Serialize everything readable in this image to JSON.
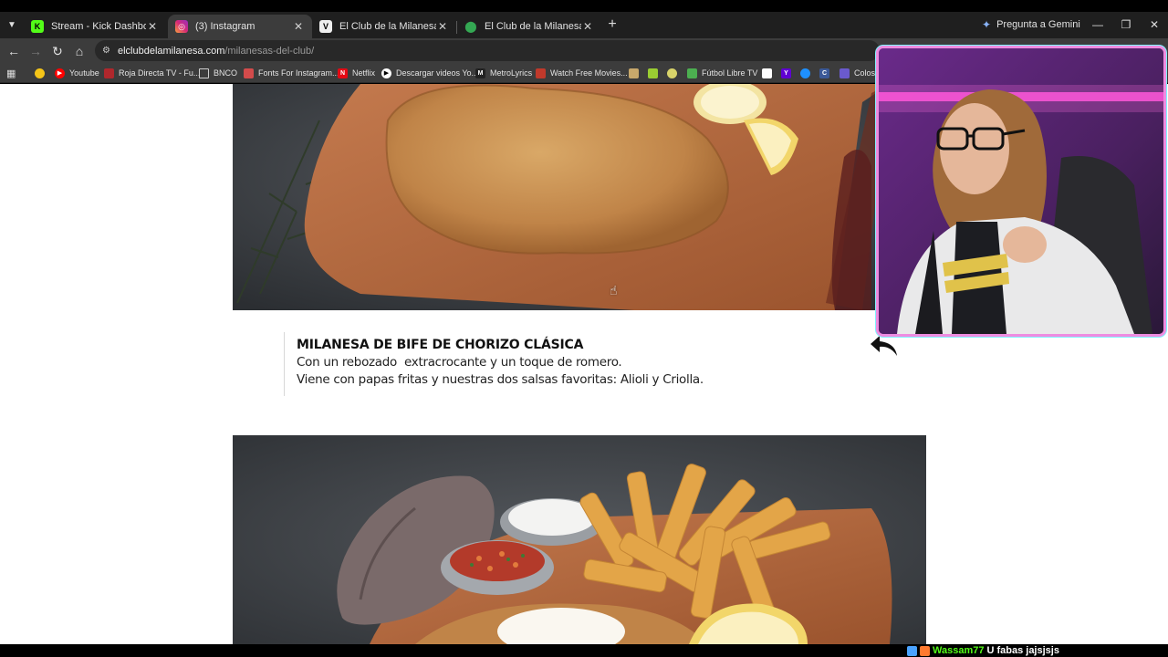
{
  "browser": {
    "tabs": [
      {
        "label": "Stream - Kick Dashboard",
        "icon": "kick-icon",
        "active": false
      },
      {
        "label": "(3) Instagram",
        "icon": "instagram-icon",
        "active": true
      },
      {
        "label": "El Club de la Milanesa – milanesas",
        "icon": "site-icon",
        "active": false
      },
      {
        "label": "El Club de la Milanesa - Castelar",
        "icon": "maps-pin-icon",
        "active": false
      }
    ],
    "gemini_label": "Pregunta a Gemini",
    "url_host": "elclubdelamilanesa.com",
    "url_path": "/milanesas-del-club/",
    "bookmarks": [
      {
        "label": "",
        "icon": "emoji-icon",
        "color": "#f5c518"
      },
      {
        "label": "Youtube",
        "icon": "youtube-icon",
        "color": "#ff0000"
      },
      {
        "label": "Roja Directa TV - Fu...",
        "icon": "roja-icon",
        "color": "#b0272c"
      },
      {
        "label": "BNCO",
        "icon": "folder-icon",
        "color": "#cfcfcf"
      },
      {
        "label": "Fonts For Instagram...",
        "icon": "fonts-icon",
        "color": "#d34b4b"
      },
      {
        "label": "Netflix",
        "icon": "netflix-icon",
        "color": "#e50914"
      },
      {
        "label": "Descargar videos Yo...",
        "icon": "download-icon",
        "color": "#ffffff"
      },
      {
        "label": "MetroLyrics",
        "icon": "metrolyrics-icon",
        "color": "#222222"
      },
      {
        "label": "Watch Free Movies...",
        "icon": "movies-icon",
        "color": "#c0392b"
      },
      {
        "label": "Fútbol Libre TV",
        "icon": "futbol-icon",
        "color": "#4caf50"
      },
      {
        "label": "Coloss...",
        "icon": "coloss-icon",
        "color": "#6a5acd"
      }
    ]
  },
  "page": {
    "dish_title": "MILANESA DE BIFE DE CHORIZO CLÁSICA",
    "dish_line1": "Con un rebozado  extracrocante y un toque de romero.",
    "dish_line2": "Viene con papas fritas y nuestras dos salsas favoritas: Alioli y Criolla."
  },
  "chat": {
    "username": "Wassam77",
    "message": "U fabas jajsjsjs"
  }
}
